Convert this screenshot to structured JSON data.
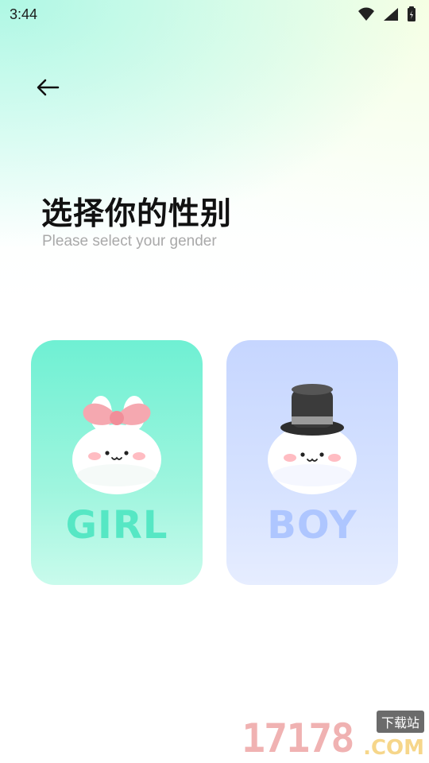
{
  "status_bar": {
    "time": "3:44"
  },
  "navigation": {
    "back_icon": "arrow-left-icon"
  },
  "header": {
    "title": "选择你的性别",
    "subtitle": "Please select your gender"
  },
  "options": [
    {
      "label": "GIRL",
      "accent": "#56e7c4",
      "card_color": "#6ff0d3",
      "mascot": "bunny-with-pink-bow"
    },
    {
      "label": "BOY",
      "accent": "#aec6ff",
      "card_color": "#c6d6ff",
      "mascot": "bunny-with-top-hat"
    }
  ],
  "watermark": {
    "number": "17178",
    "domain": ".COM",
    "tag": "下载站"
  }
}
